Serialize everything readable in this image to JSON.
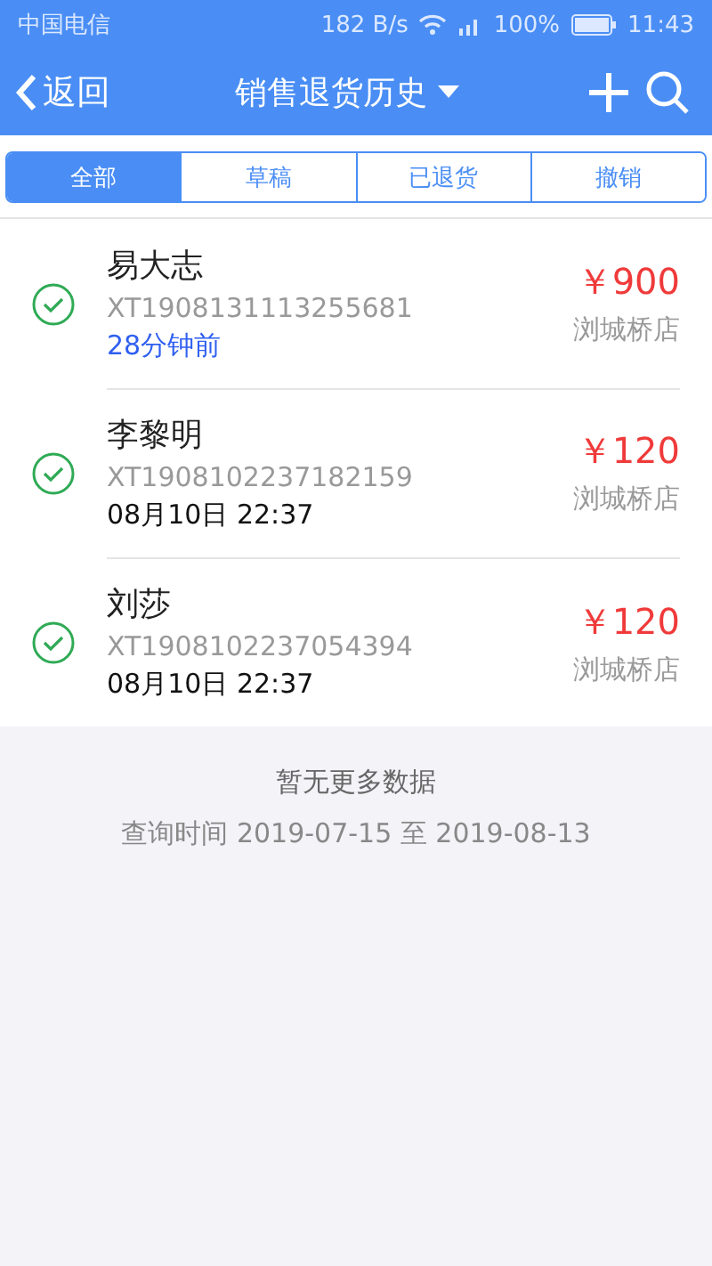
{
  "status_bar": {
    "carrier": "中国电信",
    "speed": "182 B/s",
    "battery": "100%",
    "time": "11:43"
  },
  "header": {
    "back": "返回",
    "title": "销售退货历史"
  },
  "tabs": [
    {
      "label": "全部",
      "selected": true
    },
    {
      "label": "草稿",
      "selected": false
    },
    {
      "label": "已退货",
      "selected": false
    },
    {
      "label": "撤销",
      "selected": false
    }
  ],
  "orders": [
    {
      "customer": "易大志",
      "number": "XT1908131113255681",
      "time": "28分钟前",
      "recent": true,
      "amount": "￥900",
      "store": "浏城桥店",
      "completed": true
    },
    {
      "customer": "李黎明",
      "number": "XT1908102237182159",
      "time": "08月10日 22:37",
      "recent": false,
      "amount": "￥120",
      "store": "浏城桥店",
      "completed": true
    },
    {
      "customer": "刘莎",
      "number": "XT1908102237054394",
      "time": "08月10日 22:37",
      "recent": false,
      "amount": "￥120",
      "store": "浏城桥店",
      "completed": true
    }
  ],
  "footer": {
    "message": "暂无更多数据",
    "range": "查询时间 2019-07-15 至 2019-08-13"
  }
}
